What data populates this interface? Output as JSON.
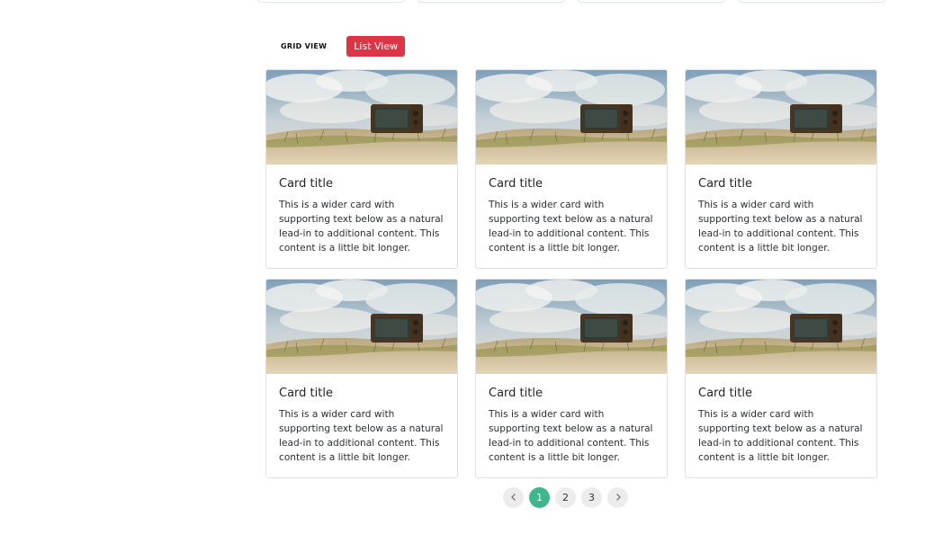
{
  "colors": {
    "accent_red": "#dc3545",
    "accent_green": "#3fb68b"
  },
  "view_toggle": {
    "grid_label": "GRID VIEW",
    "list_label": "List View"
  },
  "cards": [
    {
      "title": "Card title",
      "text": "This is a wider card with supporting text below as a natural lead-in to additional content. This content is a little bit longer."
    },
    {
      "title": "Card title",
      "text": "This is a wider card with supporting text below as a natural lead-in to additional content. This content is a little bit longer."
    },
    {
      "title": "Card title",
      "text": "This is a wider card with supporting text below as a natural lead-in to additional content. This content is a little bit longer."
    },
    {
      "title": "Card title",
      "text": "This is a wider card with supporting text below as a natural lead-in to additional content. This content is a little bit longer."
    },
    {
      "title": "Card title",
      "text": "This is a wider card with supporting text below as a natural lead-in to additional content. This content is a little bit longer."
    },
    {
      "title": "Card title",
      "text": "This is a wider card with supporting text below as a natural lead-in to additional content. This content is a little bit longer."
    }
  ],
  "pagination": {
    "prev_icon": "chevron-left-icon",
    "next_icon": "chevron-right-icon",
    "pages": [
      "1",
      "2",
      "3"
    ],
    "active": "1"
  }
}
